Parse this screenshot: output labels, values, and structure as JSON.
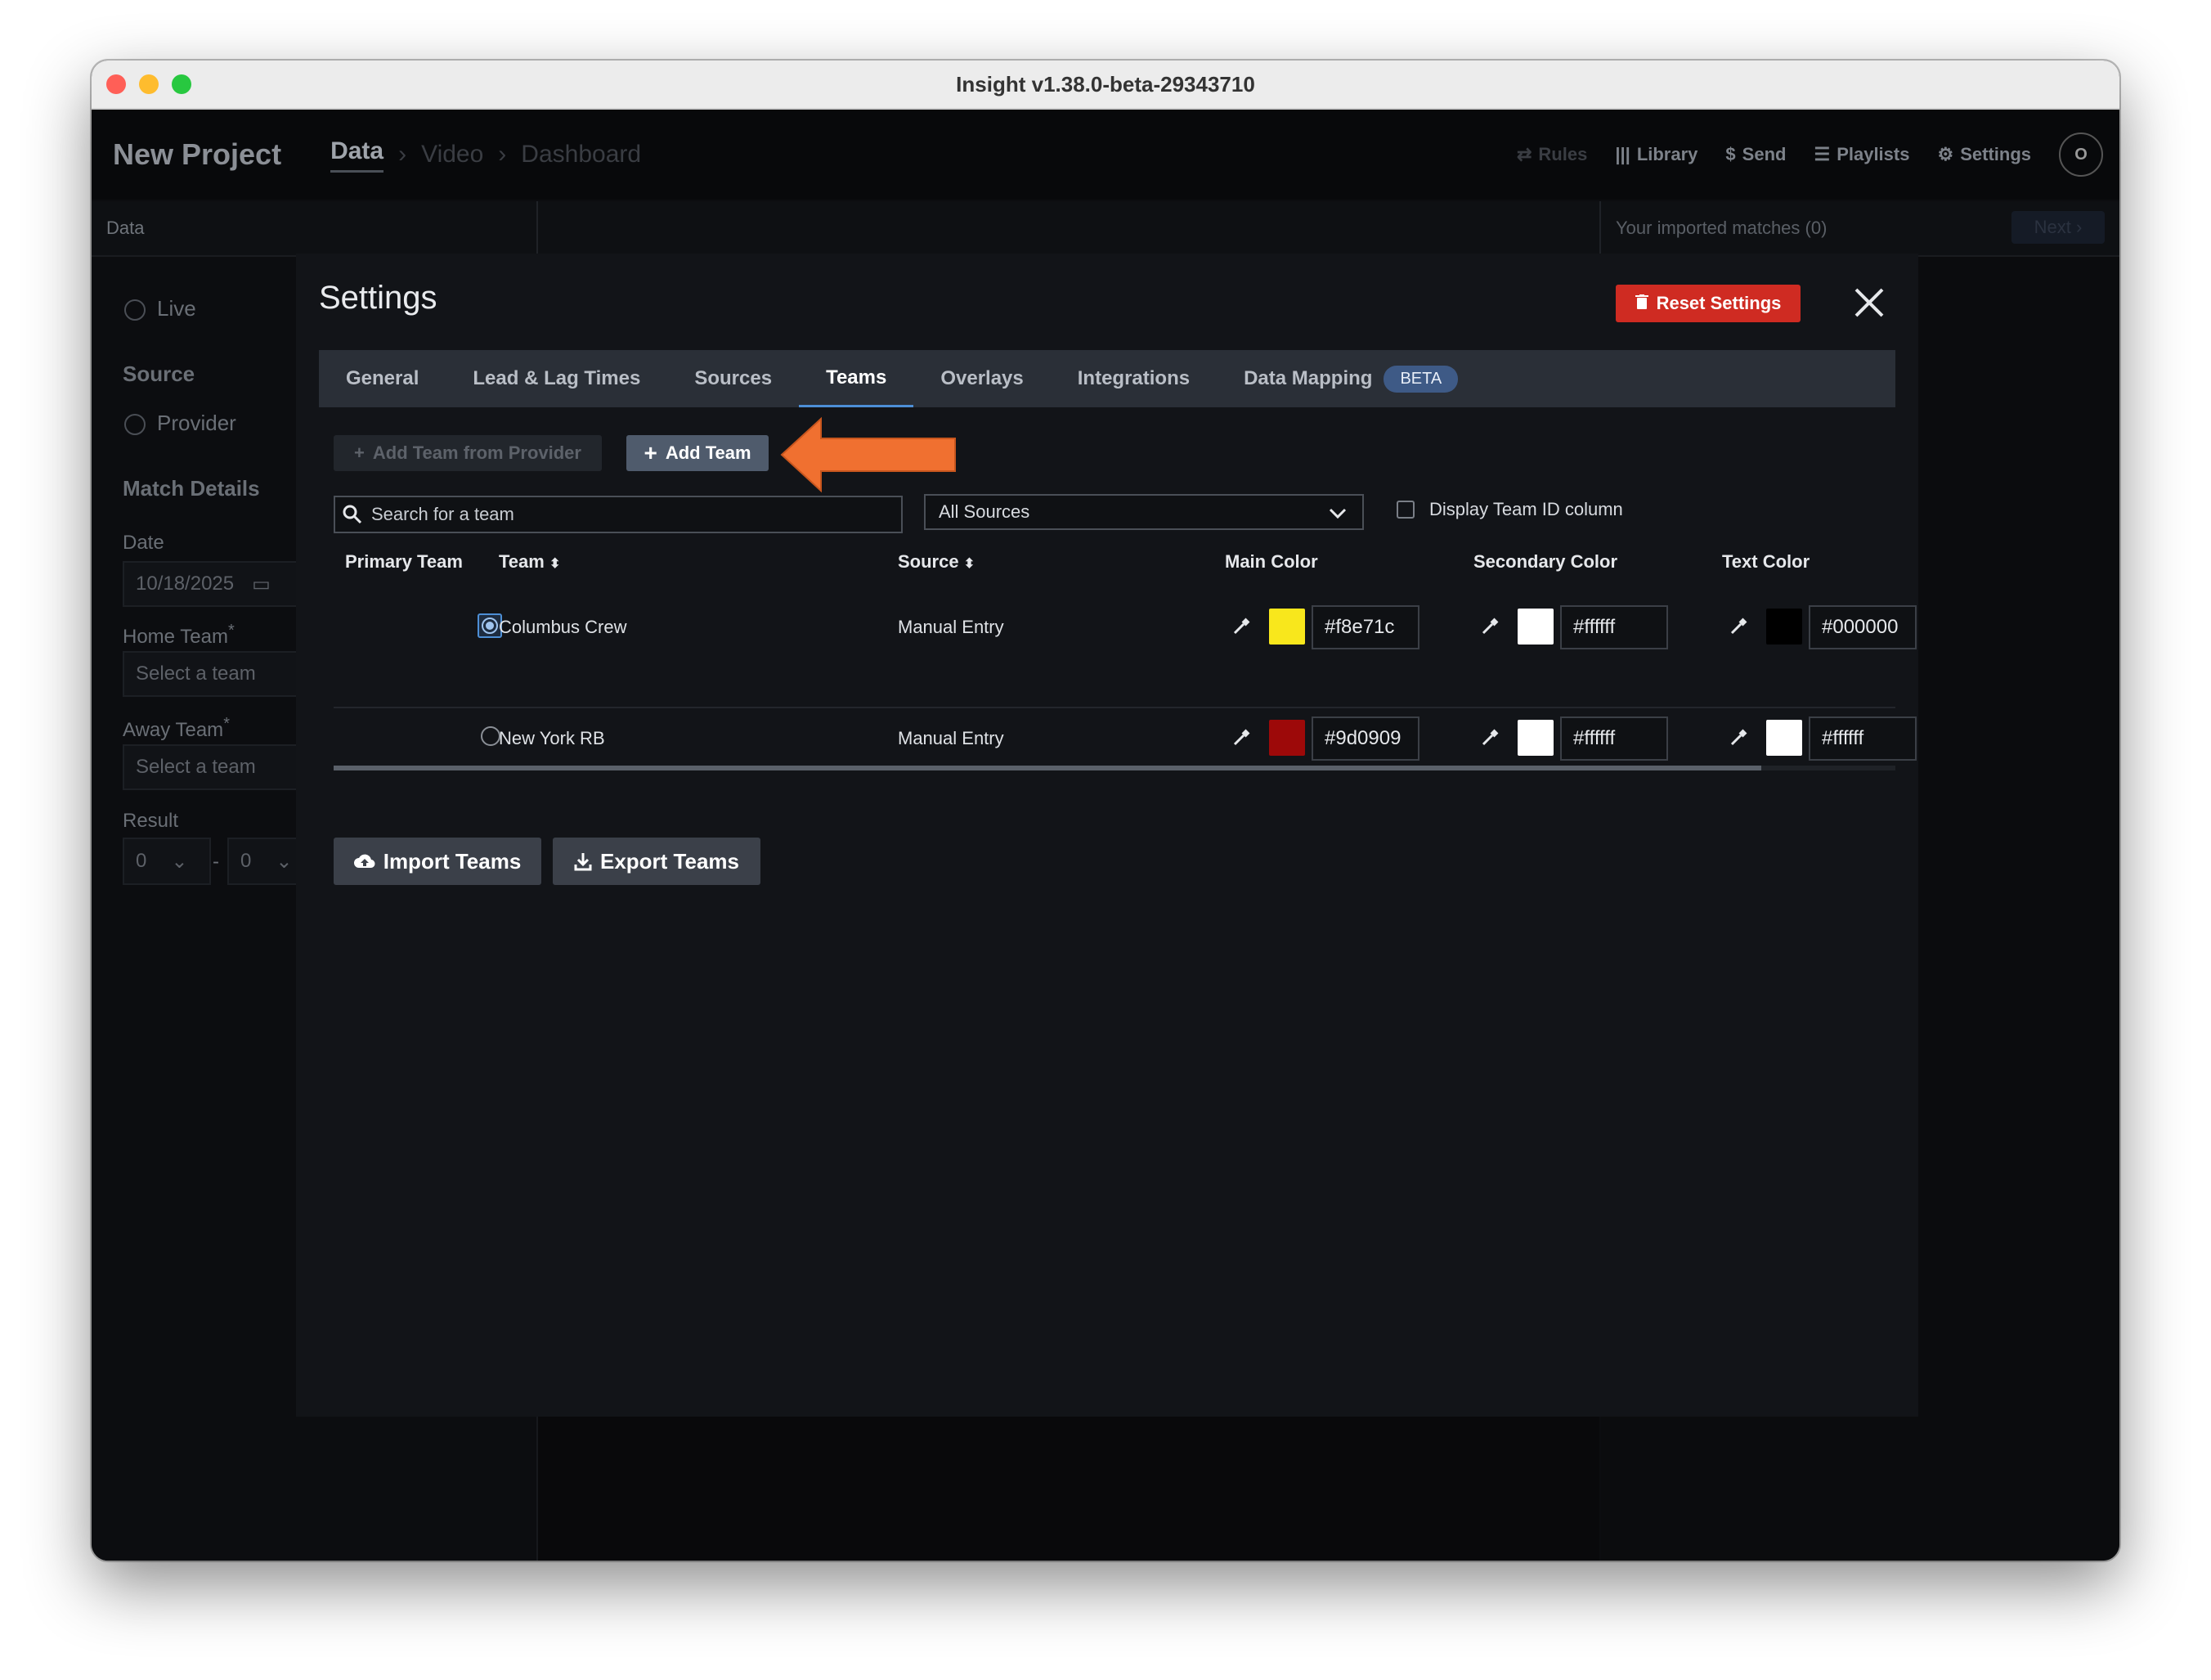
{
  "window": {
    "title": "Insight v1.38.0-beta-29343710"
  },
  "app": {
    "project_title": "New Project",
    "breadcrumbs": [
      "Data",
      "Video",
      "Dashboard"
    ],
    "nav": {
      "rules": "Rules",
      "library": "Library",
      "send": "Send",
      "playlists": "Playlists",
      "settings": "Settings",
      "avatar_initial": "O"
    },
    "subbar": {
      "label": "Data",
      "imported": "Your imported matches (0)",
      "next": "Next"
    },
    "left": {
      "live": "Live",
      "source_heading": "Source",
      "provider": "Provider",
      "match_details": "Match Details",
      "date_label": "Date",
      "date_value": "10/18/2025",
      "home_team_label": "Home Team",
      "away_team_label": "Away Team",
      "select_placeholder": "Select a team",
      "result_label": "Result",
      "result_home": "0",
      "result_away": "0",
      "required_mark": "*"
    }
  },
  "settings": {
    "title": "Settings",
    "reset_label": "Reset Settings",
    "tabs": [
      "General",
      "Lead & Lag Times",
      "Sources",
      "Teams",
      "Overlays",
      "Integrations",
      "Data Mapping"
    ],
    "active_tab": "Teams",
    "beta_badge": "BETA",
    "add_from_provider": "Add Team from Provider",
    "add_team": "Add Team",
    "search_placeholder": "Search for a team",
    "source_filter": "All Sources",
    "display_id_label": "Display Team ID column",
    "columns": {
      "primary": "Primary Team",
      "team": "Team",
      "source": "Source",
      "main": "Main Color",
      "secondary": "Secondary Color",
      "text": "Text Color"
    },
    "teams": [
      {
        "name": "Columbus Crew",
        "source": "Manual Entry",
        "primary": true,
        "main": "#f8e71c",
        "secondary": "#ffffff",
        "text": "#000000"
      },
      {
        "name": "New York RB",
        "source": "Manual Entry",
        "primary": false,
        "main": "#9d0909",
        "secondary": "#ffffff",
        "text": "#ffffff"
      }
    ],
    "import_label": "Import Teams",
    "export_label": "Export Teams"
  },
  "colors": {
    "accent": "#4d8fd6",
    "danger": "#cf2b22",
    "arrow": "#f07030"
  }
}
